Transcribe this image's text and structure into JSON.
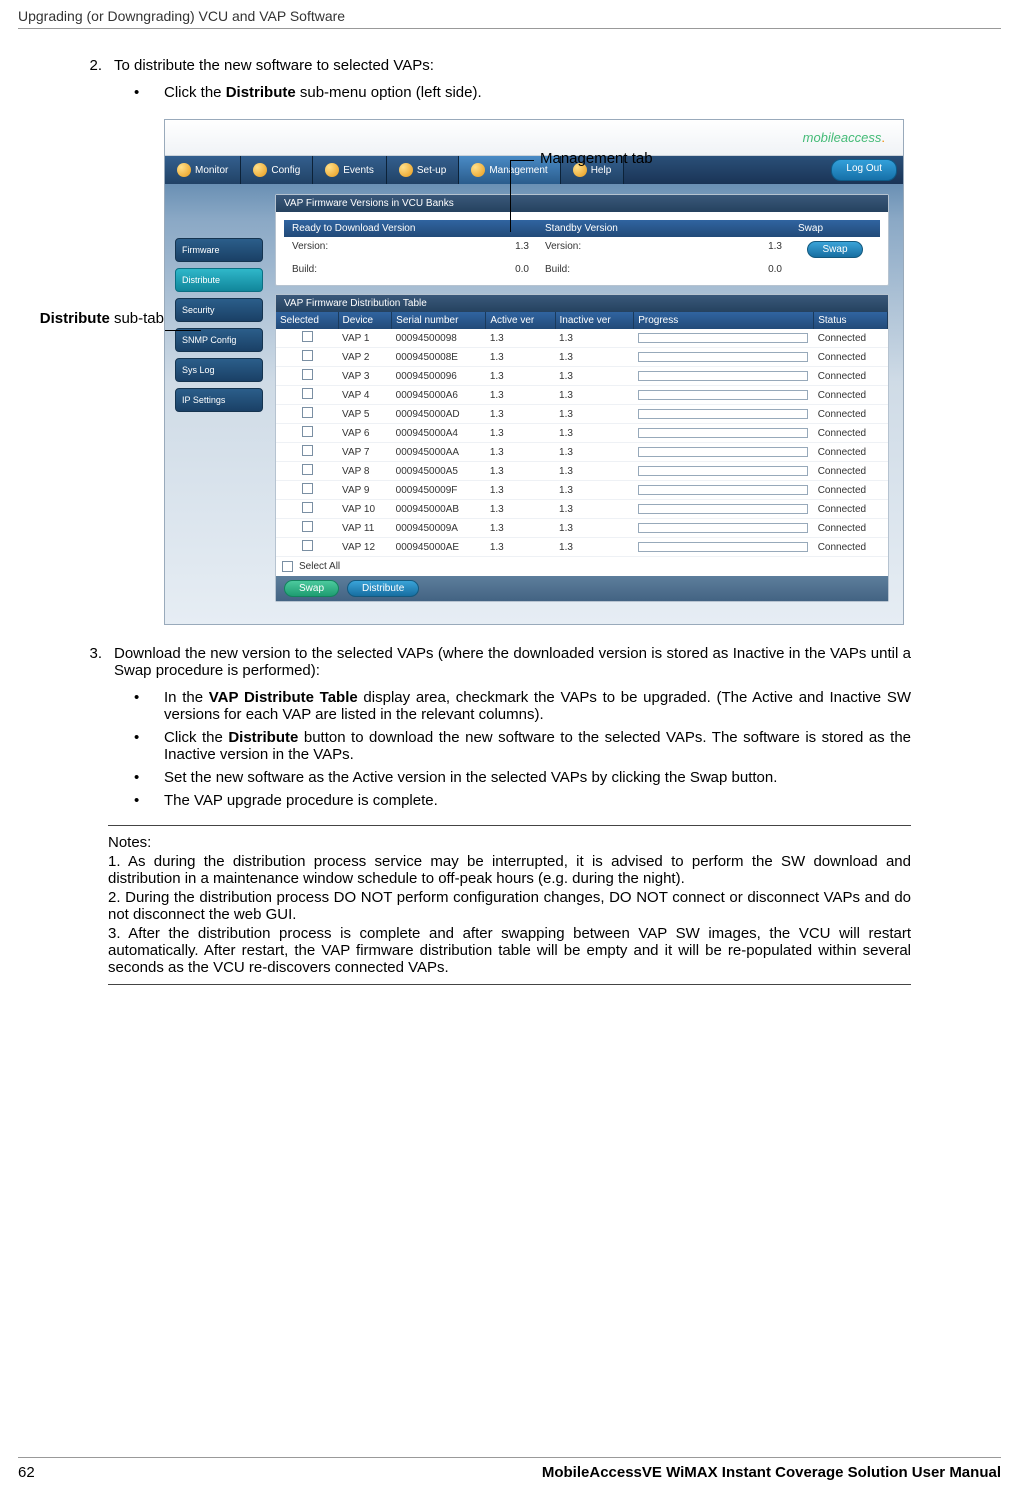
{
  "header": {
    "title": "Upgrading (or Downgrading) VCU and VAP Software"
  },
  "callouts": {
    "management_tab": "Management tab",
    "distribute_sub_tab_bold": "Distribute",
    "distribute_sub_tab_rest": " sub-tab"
  },
  "steps": {
    "s2": {
      "num": "2.",
      "text": "To distribute the new software to selected VAPs:"
    },
    "s2b1_pre": "Click the ",
    "s2b1_bold": "Distribute",
    "s2b1_post": " sub-menu option (left side).",
    "s3": {
      "num": "3.",
      "text": "Download the new version to the selected VAPs (where the downloaded version is stored as Inactive in the VAPs until a Swap procedure is performed):"
    },
    "s3b1_pre": "In the ",
    "s3b1_bold": "VAP Distribute Table",
    "s3b1_post": " display area, checkmark the VAPs to be upgraded.  (The Active and Inactive SW versions for each VAP are listed in the relevant columns).",
    "s3b2_pre": "Click the ",
    "s3b2_bold": "Distribute",
    "s3b2_post": " button to download the new software to the selected VAPs. The software is stored as the Inactive version in the VAPs.",
    "s3b3": "Set the new software as the Active version in the selected VAPs by clicking the Swap button.",
    "s3b4": "The VAP upgrade procedure is complete."
  },
  "notes": {
    "title": "Notes:",
    "n1": "1. As during the distribution process service may be interrupted, it is advised to perform the SW download and distribution in a maintenance window schedule to off-peak hours (e.g. during the night).",
    "n2": "2. During the distribution process DO NOT perform configuration changes, DO NOT connect or disconnect VAPs and do not disconnect the web GUI.",
    "n3": "3. After the distribution process is complete and after swapping between VAP SW images, the VCU will restart automatically. After restart, the VAP firmware distribution table will be empty and it will be re-populated within several seconds as the VCU re-discovers connected VAPs."
  },
  "footer": {
    "page": "62",
    "doc": "MobileAccessVE WiMAX Instant Coverage Solution User Manual"
  },
  "screenshot": {
    "logo": "mobileaccess",
    "nav": [
      "Monitor",
      "Config",
      "Events",
      "Set-up",
      "Management",
      "Help"
    ],
    "logout": "Log Out",
    "sidebar": [
      "Firmware",
      "Distribute",
      "Security",
      "SNMP Config",
      "Sys Log",
      "IP Settings"
    ],
    "sidebar_active_index": 1,
    "banks_title": "VAP Firmware Versions in VCU Banks",
    "bank_headers": [
      "Ready to Download Version",
      "Standby Version",
      "Swap"
    ],
    "bank_labels": {
      "version": "Version:",
      "build": "Build:"
    },
    "bank_values": {
      "ready": {
        "version": "1.3",
        "build": "0.0"
      },
      "standby": {
        "version": "1.3",
        "build": "0.0"
      }
    },
    "swap_btn": "Swap",
    "dist_title": "VAP Firmware Distribution Table",
    "columns": [
      "Selected",
      "Device",
      "Serial number",
      "Active ver",
      "Inactive ver",
      "Progress",
      "Status"
    ],
    "rows": [
      {
        "device": "VAP 1",
        "serial": "00094500098",
        "active": "1.3",
        "inactive": "1.3",
        "status": "Connected"
      },
      {
        "device": "VAP 2",
        "serial": "0009450008E",
        "active": "1.3",
        "inactive": "1.3",
        "status": "Connected"
      },
      {
        "device": "VAP 3",
        "serial": "00094500096",
        "active": "1.3",
        "inactive": "1.3",
        "status": "Connected"
      },
      {
        "device": "VAP 4",
        "serial": "000945000A6",
        "active": "1.3",
        "inactive": "1.3",
        "status": "Connected"
      },
      {
        "device": "VAP 5",
        "serial": "000945000AD",
        "active": "1.3",
        "inactive": "1.3",
        "status": "Connected"
      },
      {
        "device": "VAP 6",
        "serial": "000945000A4",
        "active": "1.3",
        "inactive": "1.3",
        "status": "Connected"
      },
      {
        "device": "VAP 7",
        "serial": "000945000AA",
        "active": "1.3",
        "inactive": "1.3",
        "status": "Connected"
      },
      {
        "device": "VAP 8",
        "serial": "000945000A5",
        "active": "1.3",
        "inactive": "1.3",
        "status": "Connected"
      },
      {
        "device": "VAP 9",
        "serial": "0009450009F",
        "active": "1.3",
        "inactive": "1.3",
        "status": "Connected"
      },
      {
        "device": "VAP 10",
        "serial": "000945000AB",
        "active": "1.3",
        "inactive": "1.3",
        "status": "Connected"
      },
      {
        "device": "VAP 11",
        "serial": "0009450009A",
        "active": "1.3",
        "inactive": "1.3",
        "status": "Connected"
      },
      {
        "device": "VAP 12",
        "serial": "000945000AE",
        "active": "1.3",
        "inactive": "1.3",
        "status": "Connected"
      }
    ],
    "select_all": "Select All",
    "action_swap": "Swap",
    "action_distribute": "Distribute"
  }
}
